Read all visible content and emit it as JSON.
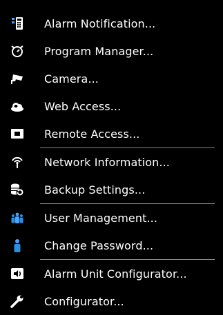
{
  "menu": {
    "items": [
      {
        "label": "Alarm Notification...",
        "icon": "alarm-panel-icon"
      },
      {
        "label": "Program Manager...",
        "icon": "stopwatch-icon"
      },
      {
        "label": "Camera...",
        "icon": "camera-icon"
      },
      {
        "label": "Web Access...",
        "icon": "cloud-icon"
      },
      {
        "label": "Remote Access...",
        "icon": "screen-icon"
      },
      {
        "label": "Network Information...",
        "icon": "wifi-tower-icon"
      },
      {
        "label": "Backup Settings...",
        "icon": "database-restore-icon"
      },
      {
        "label": "User Management...",
        "icon": "users-icon"
      },
      {
        "label": "Change Password...",
        "icon": "user-icon"
      },
      {
        "label": "Alarm Unit Configurator...",
        "icon": "speaker-icon"
      },
      {
        "label": "Configurator...",
        "icon": "wrench-icon"
      }
    ]
  },
  "colors": {
    "background": "#000000",
    "text": "#ffffff",
    "separator": "#8c8c8c",
    "accent_blue": "#2b8fe0"
  }
}
